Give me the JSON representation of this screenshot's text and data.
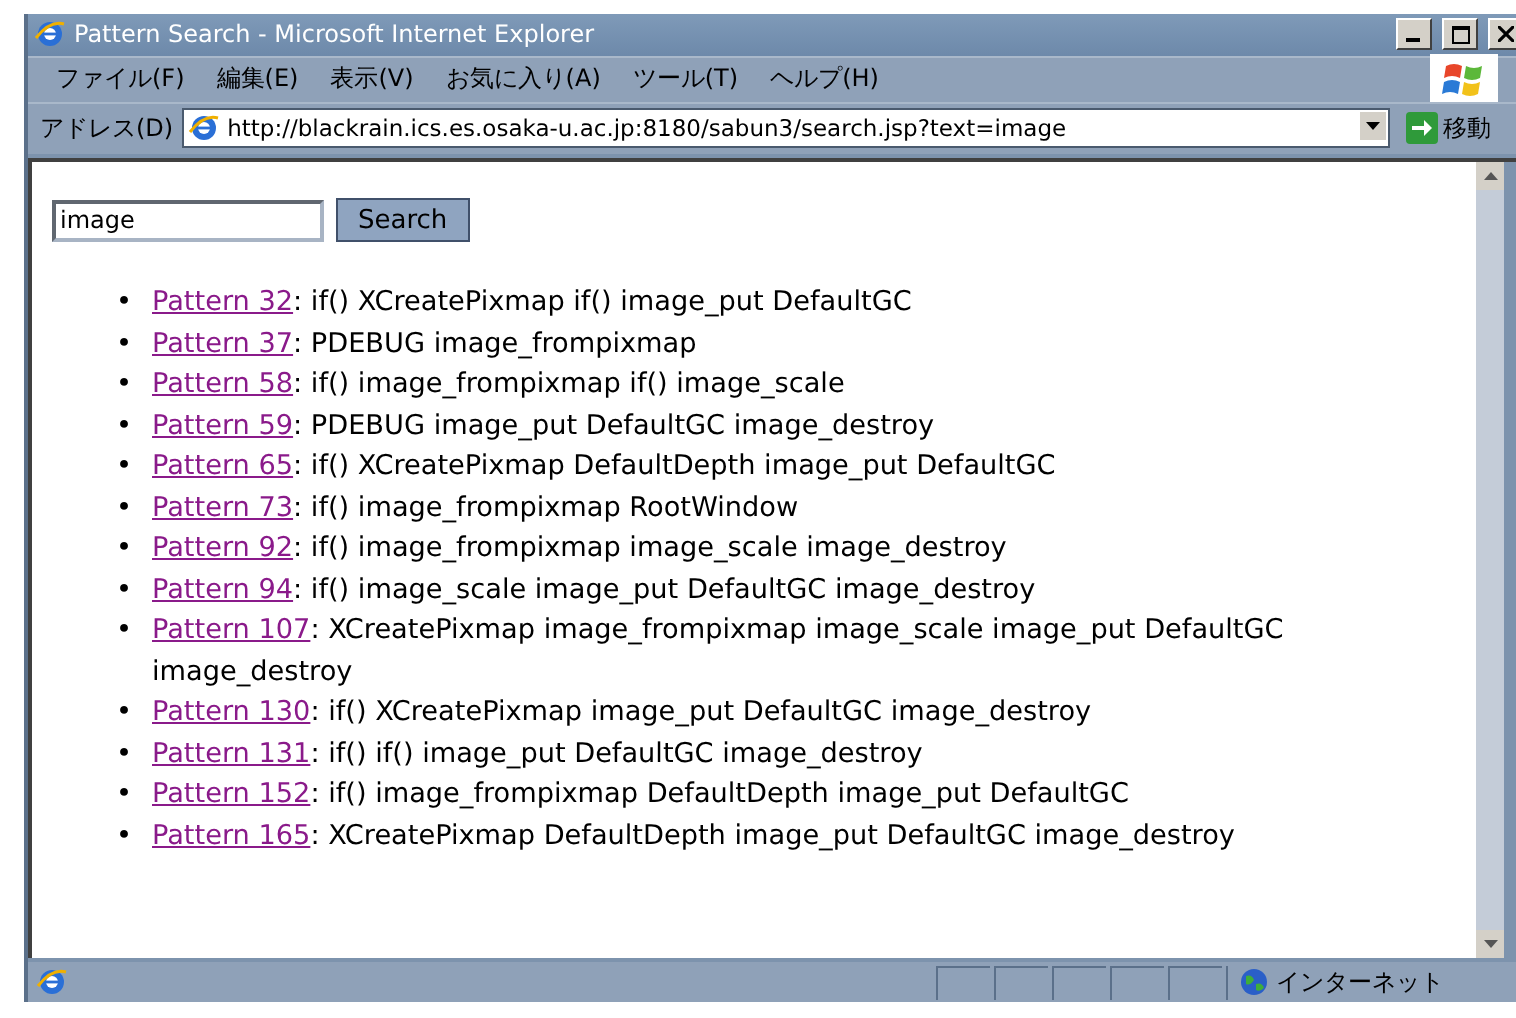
{
  "window": {
    "title": "Pattern Search - Microsoft Internet Explorer"
  },
  "menu": [
    "ファイル(F)",
    "編集(E)",
    "表示(V)",
    "お気に入り(A)",
    "ツール(T)",
    "ヘルプ(H)"
  ],
  "address_bar": {
    "label": "アドレス(D)",
    "url": "http://blackrain.ics.es.osaka-u.ac.jp:8180/sabun3/search.jsp?text=image",
    "go": "移動"
  },
  "search": {
    "value": "image",
    "button": "Search"
  },
  "bullet": "•",
  "results": [
    {
      "link": "Pattern 32",
      "text": ": if() XCreatePixmap if() image_put DefaultGC"
    },
    {
      "link": "Pattern 37",
      "text": ": PDEBUG image_frompixmap"
    },
    {
      "link": "Pattern 58",
      "text": ": if() image_frompixmap if() image_scale"
    },
    {
      "link": "Pattern 59",
      "text": ": PDEBUG image_put DefaultGC image_destroy"
    },
    {
      "link": "Pattern 65",
      "text": ": if() XCreatePixmap DefaultDepth image_put DefaultGC"
    },
    {
      "link": "Pattern 73",
      "text": ": if() image_frompixmap RootWindow"
    },
    {
      "link": "Pattern 92",
      "text": ": if() image_frompixmap image_scale image_destroy"
    },
    {
      "link": "Pattern 94",
      "text": ": if() image_scale image_put DefaultGC image_destroy"
    },
    {
      "link": "Pattern 107",
      "text": ": XCreatePixmap image_frompixmap image_scale image_put DefaultGC image_destroy"
    },
    {
      "link": "Pattern 130",
      "text": ": if() XCreatePixmap image_put DefaultGC image_destroy"
    },
    {
      "link": "Pattern 131",
      "text": ": if() if() image_put DefaultGC image_destroy"
    },
    {
      "link": "Pattern 152",
      "text": ": if() image_frompixmap DefaultDepth image_put DefaultGC"
    },
    {
      "link": "Pattern 165",
      "text": ": XCreatePixmap DefaultDepth image_put DefaultGC image_destroy"
    }
  ],
  "status_bar": {
    "zone": "インターネット"
  }
}
